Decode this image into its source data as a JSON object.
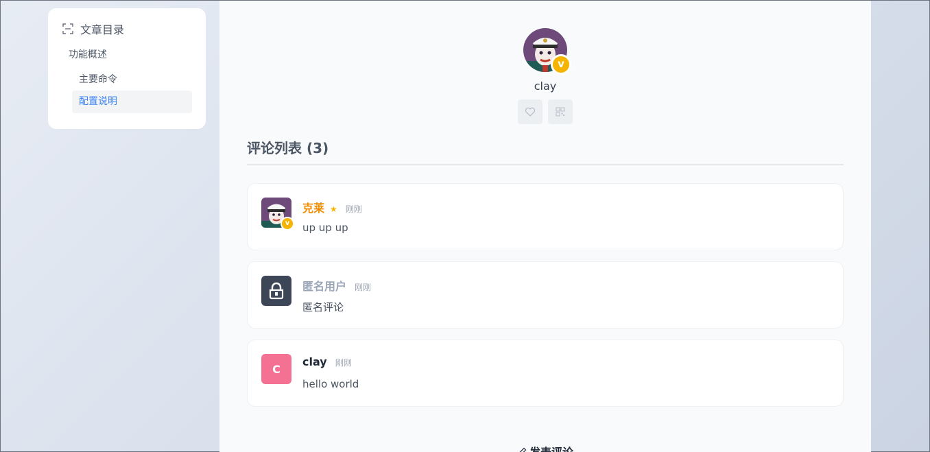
{
  "toc": {
    "title": "文章目录",
    "items": [
      {
        "label": "功能概述",
        "level": 1,
        "active": false
      },
      {
        "label": "主要命令",
        "level": 2,
        "active": false
      },
      {
        "label": "配置说明",
        "level": 2,
        "active": true
      }
    ]
  },
  "author": {
    "name": "clay",
    "badge": "v",
    "actions": [
      {
        "icon": "heart-icon"
      },
      {
        "icon": "qrcode-icon"
      }
    ]
  },
  "comments": {
    "title": "评论列表 (3)",
    "items": [
      {
        "name": "克莱",
        "name_color": "#f08c00",
        "star": "★",
        "time": "刚刚",
        "text": "up up up",
        "avatar": "photo",
        "badge": "v"
      },
      {
        "name": "匿名用户",
        "name_color": "#9aa6b8",
        "time": "刚刚",
        "text": "匿名评论",
        "avatar": "lock-icon"
      },
      {
        "name": "clay",
        "name_color": "#1f2937",
        "time": "刚刚",
        "text": "hello world",
        "avatar_letter": "C"
      }
    ]
  },
  "post_comment_label": "发表评论",
  "colors": {
    "accent": "#3b82f6",
    "badge": "#f5b400",
    "letter_avatar": "#f57193"
  }
}
